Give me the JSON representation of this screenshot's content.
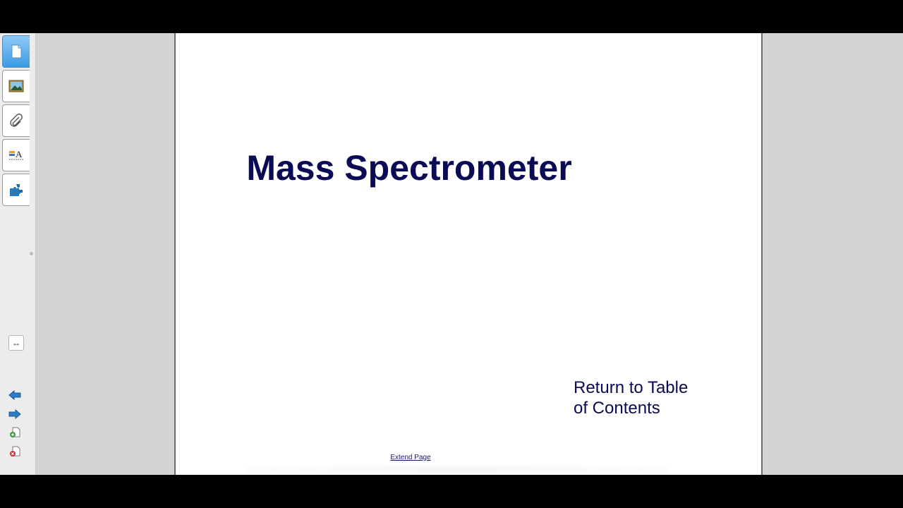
{
  "side_panel": {
    "tabs": [
      {
        "name": "page-sorter-tab",
        "icon": "page-icon",
        "active": true
      },
      {
        "name": "gallery-tab",
        "icon": "picture-icon",
        "active": false
      },
      {
        "name": "attachments-tab",
        "icon": "paperclip-icon",
        "active": false
      },
      {
        "name": "properties-tab",
        "icon": "text-properties-icon",
        "active": false
      },
      {
        "name": "addons-tab",
        "icon": "puzzle-icon",
        "active": false
      }
    ],
    "resize_label": "↔"
  },
  "page": {
    "title": "Mass Spectrometer",
    "return_link_line1": "Return to Table",
    "return_link_line2": "of Contents",
    "extend_page": "Extend Page"
  },
  "colors": {
    "title": "#0a0a55",
    "active_tab": "#3a9be6",
    "workspace": "#d4d4d4"
  }
}
